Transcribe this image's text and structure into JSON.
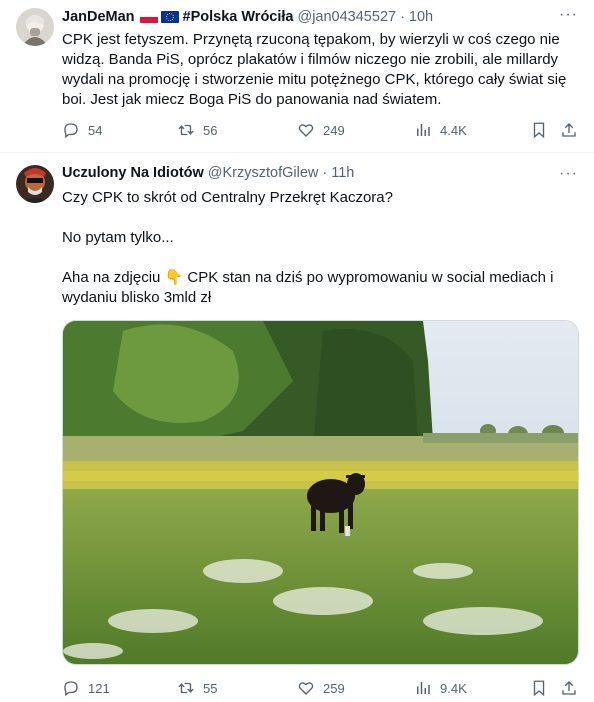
{
  "tweets": [
    {
      "display_name": "JanDeMan",
      "name_suffix": "#Polska Wróciła",
      "handle": "@jan04345527",
      "separator": "·",
      "time": "10h",
      "text": "CPK jest fetyszem.  Przynętą rzuconą tępakom, by wierzyli w coś czego nie widzą. Banda PiS, oprócz plakatów i filmów niczego nie zrobili, ale millardy wydali na promocję i stworzenie mitu potężnego CPK, którego cały świat się boi. Jest jak miecz Boga PiS do panowania nad światem.",
      "replies": "54",
      "reposts": "56",
      "likes": "249",
      "views": "4.4K",
      "more": "···"
    },
    {
      "display_name": "Uczulony Na Idiotów",
      "handle": "@KrzysztofGilew",
      "separator": "·",
      "time": "11h",
      "text_line1": "Czy CPK to skrót od Centralny Przekręt Kaczora?",
      "text_line2": "No pytam tylko...",
      "text_line3": "Aha na zdjęciu 👇 CPK stan na dziś po wypromowaniu w social mediach i wydaniu blisko 3mld zł",
      "replies": "121",
      "reposts": "55",
      "likes": "259",
      "views": "9.4K",
      "more": "···"
    }
  ],
  "colors": {
    "text": "#0f1419",
    "muted": "#536471",
    "divider": "#eff3f4"
  },
  "icons": [
    "reply-icon",
    "repost-icon",
    "like-icon",
    "views-icon",
    "bookmark-icon",
    "share-icon",
    "more-icon"
  ]
}
